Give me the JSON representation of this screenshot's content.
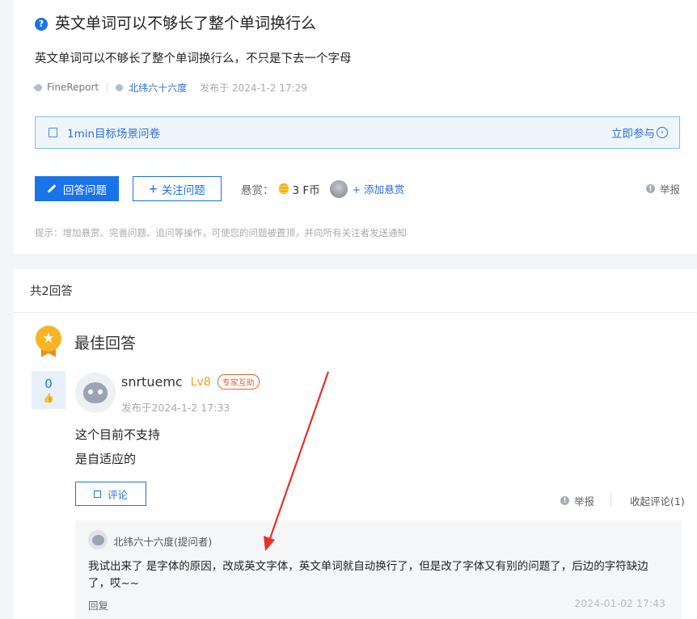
{
  "question": {
    "title": "英文单词可以不够长了整个单词换行么",
    "description": "英文单词可以不够长了整个单词换行么，不只是下去一个字母",
    "tag": "FineReport",
    "author": "北纬六十六度",
    "published": "发布于 2024-1-2 17:29"
  },
  "survey": {
    "text": "1min目标场景问卷",
    "link": "立即参与"
  },
  "actions": {
    "answer_label": "回答问题",
    "follow_label": "关注问题",
    "reward_label": "悬赏：",
    "reward_value": "3 F币",
    "add_reward_label": "+ 添加悬赏",
    "report_label": "举报"
  },
  "hint": "提示：增加悬赏、完善问题、追问等操作，可使您的问题被置顶，并向所有关注者发送通知",
  "answers": {
    "count_label": "共2回答",
    "best_label": "最佳回答",
    "best": {
      "votes": "0",
      "username": "snrtuemc",
      "level": "Lv8",
      "badge": "专家互助",
      "date": "发布于2024-1-2 17:33",
      "lines": [
        "这个目前不支持",
        "是自适应的"
      ],
      "comment_label": "评论",
      "report_label": "举报",
      "collapse_label": "收起评论(1)"
    },
    "comment": {
      "author": "北纬六十六度(提问者)",
      "text": "我试出来了 是字体的原因，改成英文字体，英文单词就自动换行了，但是改了字体又有别的问题了，后边的字符缺边了，哎~~",
      "reply_label": "回复",
      "date": "2024-01-02 17:43"
    }
  },
  "colors": {
    "accent": "#1a73e8",
    "annotation_arrow": "#e8302a"
  }
}
